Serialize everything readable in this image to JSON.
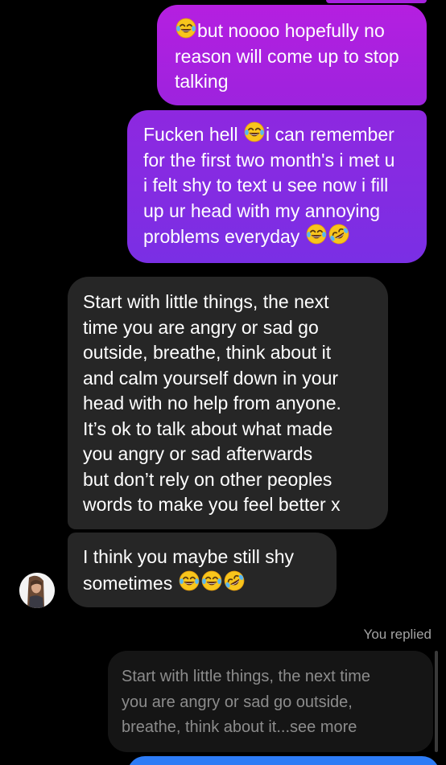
{
  "messages": [
    {
      "direction": "outgoing",
      "lines": [
        {
          "emoji_before": "laughing-tears",
          "text": "but noooo hopefully no"
        },
        {
          "text": "reason will come up to stop"
        },
        {
          "text": "talking"
        }
      ]
    },
    {
      "direction": "outgoing",
      "lines": [
        {
          "text_before": "Fucken hell ",
          "emoji": "laughing-tears",
          "text": "i can remember"
        },
        {
          "text": "for the first two month's i met u"
        },
        {
          "text": "i felt shy to text u see now i fill"
        },
        {
          "text": "up ur head with my annoying"
        },
        {
          "text": "problems everyday ",
          "emojis_after": [
            "laughing-tears",
            "rofl"
          ]
        }
      ]
    },
    {
      "direction": "incoming",
      "lines": [
        "Start with little things, the next",
        "time you are angry or sad go",
        "outside, breathe, think about it",
        "and calm yourself down in your",
        "head with no help from anyone.",
        "It’s ok to talk about what made",
        "you angry or sad afterwards",
        "but don’t rely on other peoples",
        "words to make you feel better x"
      ]
    },
    {
      "direction": "incoming",
      "lines": [
        {
          "text": "I think you maybe still shy"
        },
        {
          "text": "sometimes ",
          "emojis_after": [
            "laughing-tears",
            "laughing-tears",
            "rofl"
          ]
        }
      ]
    }
  ],
  "reply": {
    "label": "You replied",
    "quoted_lines": [
      "Start with little things, the next time",
      "you are angry or sad go outside,",
      "breathe, think about it...see more"
    ]
  },
  "colors": {
    "outgoing_gradient_top": "#b51fe0",
    "outgoing_gradient_bottom": "#7a2fe4",
    "incoming_bubble": "#262626",
    "background": "#000000",
    "next_bubble": "#2d7cf6"
  }
}
